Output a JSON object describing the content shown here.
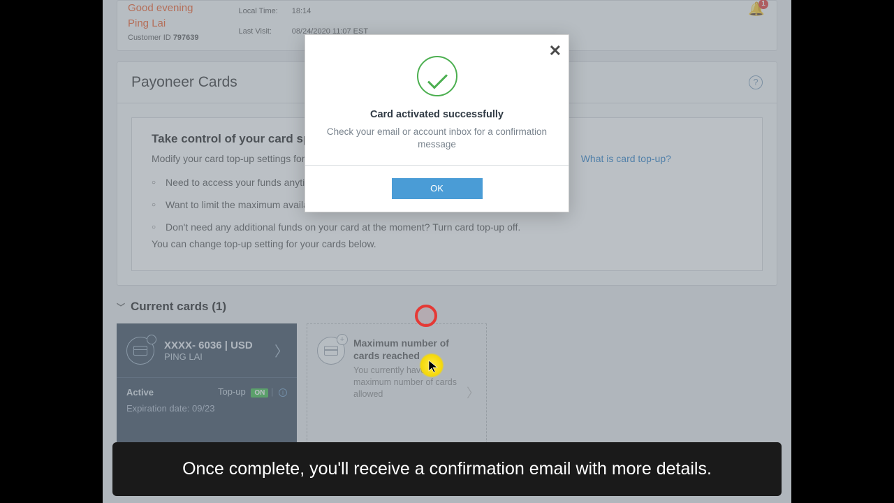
{
  "header": {
    "greeting": "Good evening",
    "user_name": "Ping Lai",
    "customer_id_label": "Customer ID",
    "customer_id": "797639",
    "local_time_label": "Local Time:",
    "local_time": "18:14",
    "last_visit_label": "Last Visit:",
    "last_visit": "08/24/2020 11:07 EST",
    "notifications": "1"
  },
  "section": {
    "title": "Payoneer Cards",
    "info_title": "Take control of your card spend",
    "info_intro": "Modify your card top-up settings for each card to manage your card use.",
    "info_link": "What is card top-up?",
    "bullets": [
      "Need to access your funds anytime? Turn card top-up on.",
      "Want to limit the maximum available balance? Set a daily limit.",
      "Don't need any additional funds on your card at the moment? Turn card top-up off."
    ],
    "info_footer": "You can change top-up setting for your cards below."
  },
  "current_cards": {
    "heading": "Current cards (1)",
    "active": {
      "number": "XXXX- 6036 | USD",
      "holder": "PING LAI",
      "status": "Active",
      "topup_label": "Top-up",
      "topup_value": "ON",
      "expiry_label": "Expiration date:",
      "expiry": "09/23"
    },
    "max": {
      "title": "Maximum number of cards reached",
      "body": "You currently have the maximum number of cards allowed"
    }
  },
  "modal": {
    "title": "Card activated successfully",
    "body": "Check your email or account inbox for a confirmation message",
    "ok": "OK"
  },
  "caption": "Once complete, you'll receive a confirmation email with more details."
}
